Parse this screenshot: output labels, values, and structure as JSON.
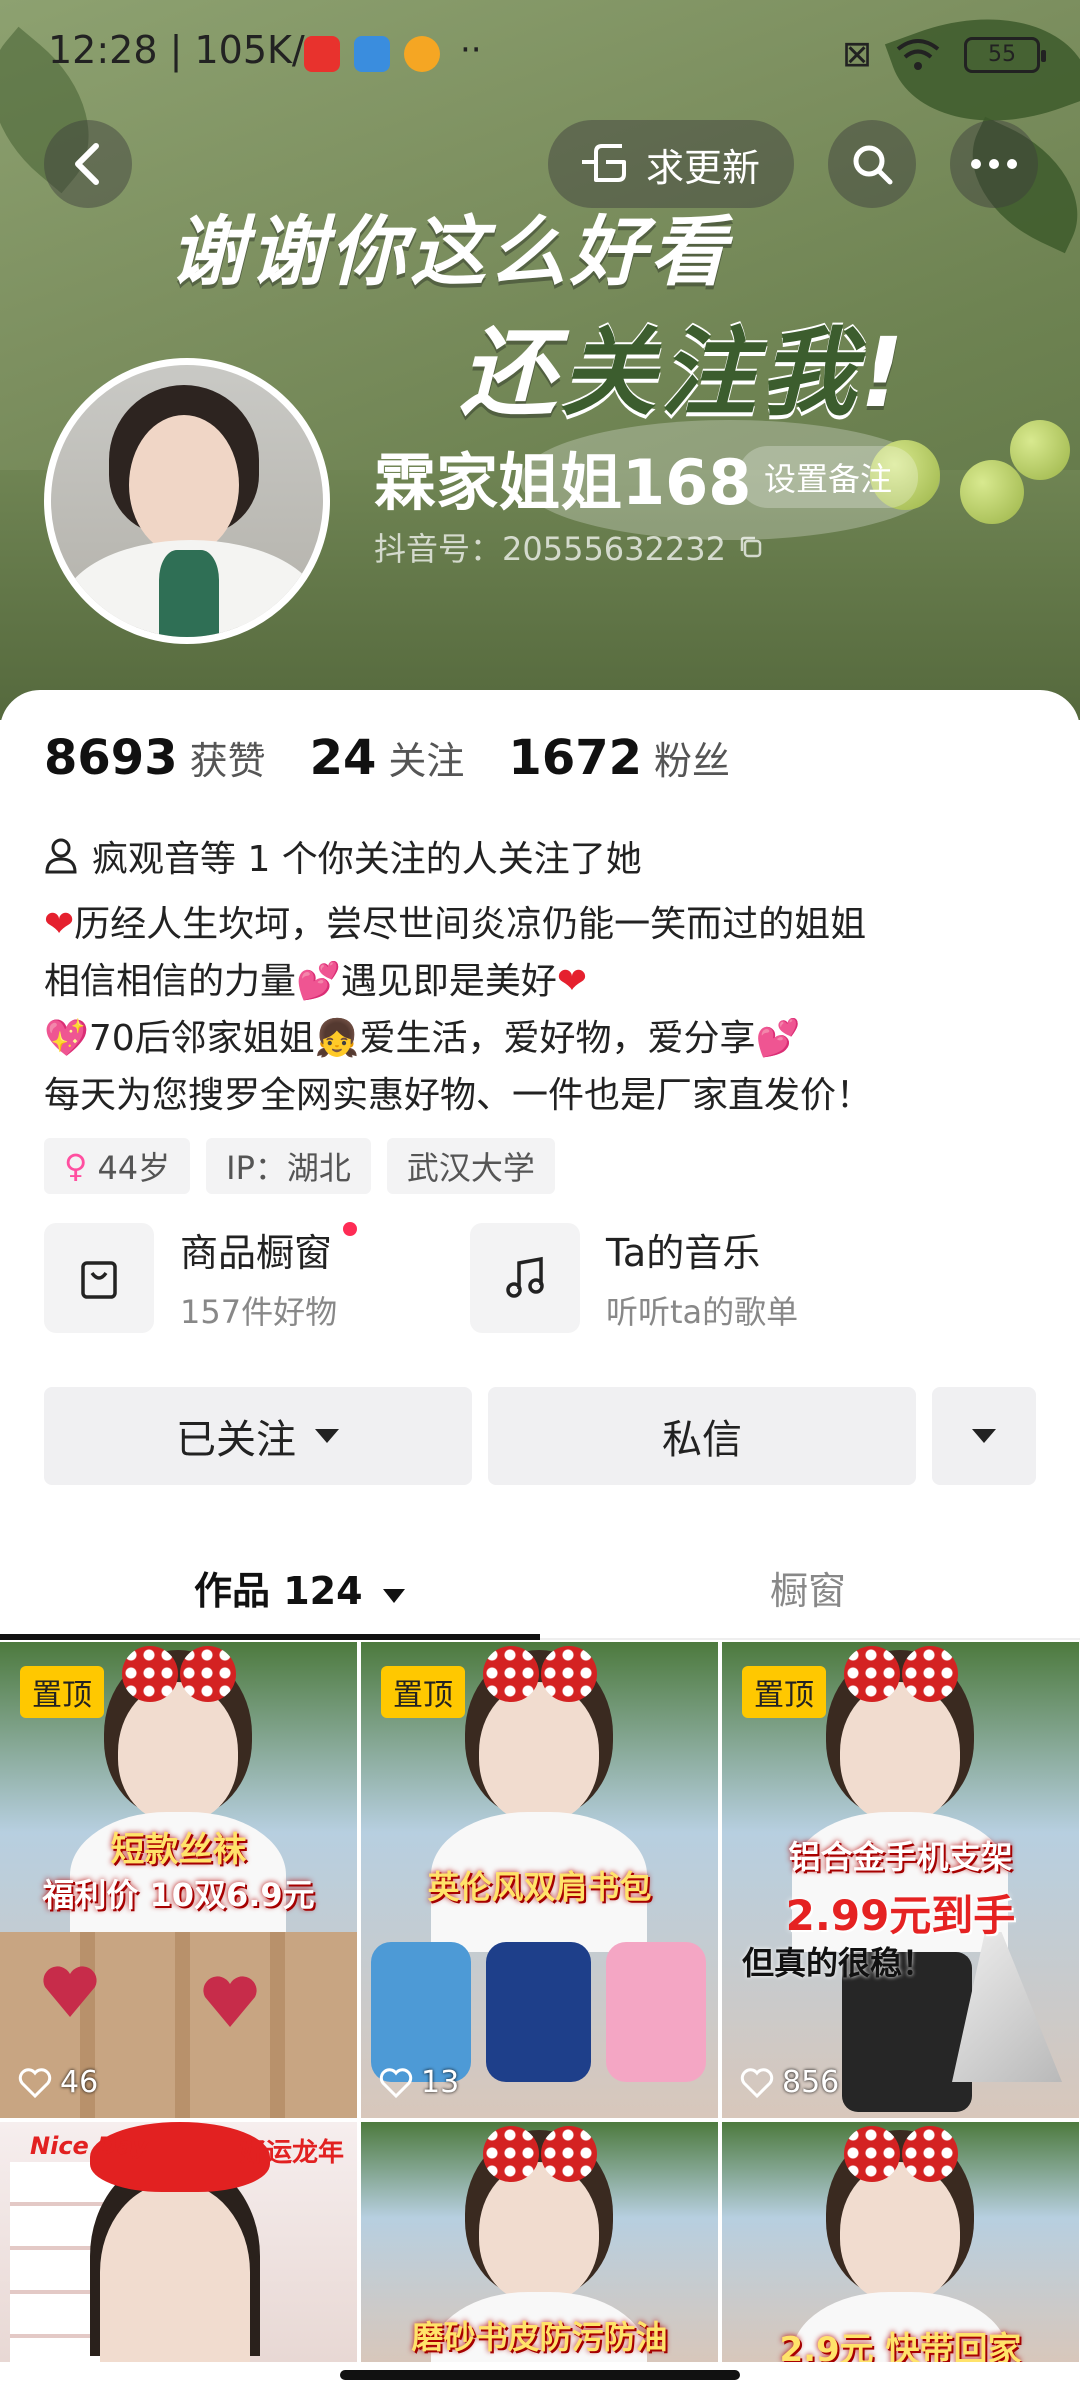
{
  "status_bar": {
    "time": "12:28",
    "speed": "105K/s",
    "battery": "55"
  },
  "header": {
    "request_update": "求更新"
  },
  "banner": {
    "line1": "谢谢你这么好看",
    "line2_prefix": "还",
    "line2_highlight": "关注我",
    "line2_suffix": "!"
  },
  "profile": {
    "name": "霖家姐姐168",
    "remark_button": "设置备注",
    "douyin_id": "抖音号：20555632232"
  },
  "stats": [
    {
      "num": "8693",
      "label": "获赞"
    },
    {
      "num": "24",
      "label": "关注"
    },
    {
      "num": "1672",
      "label": "粉丝"
    }
  ],
  "followed_by": "疯观音等 1 个你关注的人关注了她",
  "bio": {
    "line1": "历经人生坎坷，尝尽世间炎凉仍能一笑而过的姐姐",
    "line2a": "相信相信的力量",
    "line2b": "遇见即是美好",
    "line3a": "70后邻家姐姐",
    "line3b": "爱生活，爱好物，爱分享",
    "line4": "每天为您搜罗全网实惠好物、一件也是厂家直发价！"
  },
  "tags": {
    "age": "44岁",
    "ip": "IP：湖北",
    "school": "武汉大学"
  },
  "entries": {
    "shop": {
      "title": "商品橱窗",
      "subtitle": "157件好物"
    },
    "music": {
      "title": "Ta的音乐",
      "subtitle": "听听ta的歌单"
    }
  },
  "actions": {
    "followed": "已关注",
    "message": "私信"
  },
  "tabs": {
    "works": "作品 124",
    "shop": "橱窗"
  },
  "videos": [
    {
      "pinned": "置顶",
      "caption1": "短款丝袜",
      "caption2": "福利价 10双6.9元",
      "likes": "46"
    },
    {
      "pinned": "置顶",
      "caption1": "英伦风双肩书包",
      "caption2": "",
      "likes": "13"
    },
    {
      "pinned": "置顶",
      "caption1": "铝合金手机支架",
      "caption2": "2.99元到手",
      "caption3": "但真的很稳！",
      "likes": "856"
    },
    {
      "caption1": "好运龙年",
      "caption2": "Nice Day"
    },
    {
      "caption1": "磨砂书皮防污防油"
    },
    {
      "caption1": "2.9元 快带回家"
    }
  ]
}
